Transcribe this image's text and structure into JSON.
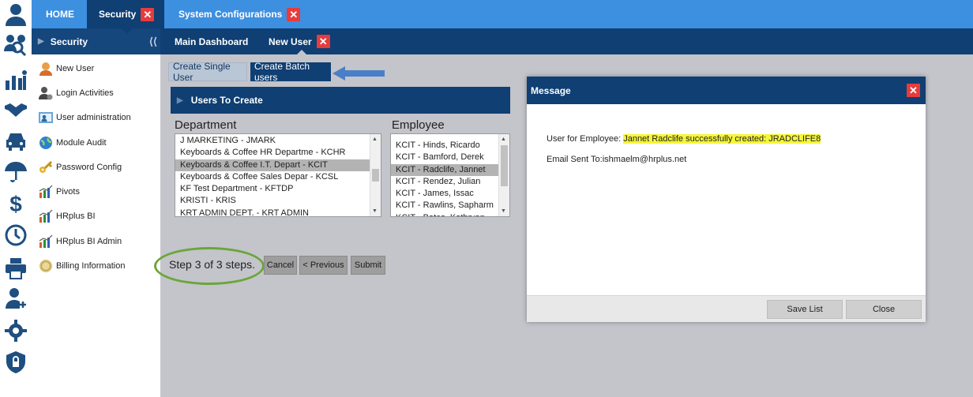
{
  "top_tabs": {
    "home": "HOME",
    "security": "Security",
    "system_configurations": "System Configurations",
    "close_glyph": "✕"
  },
  "sub_bar": {
    "section": "Security",
    "main_dashboard": "Main Dashboard",
    "new_user": "New User"
  },
  "sidebar": {
    "items": [
      {
        "label": "New User",
        "icon": "user-add-icon"
      },
      {
        "label": "Login Activities",
        "icon": "login-activity-icon"
      },
      {
        "label": "User administration",
        "icon": "user-admin-icon"
      },
      {
        "label": "Module Audit",
        "icon": "globe-icon"
      },
      {
        "label": "Password Config",
        "icon": "key-icon"
      },
      {
        "label": "Pivots",
        "icon": "bar-chart-icon"
      },
      {
        "label": "HRplus BI",
        "icon": "bar-chart-icon"
      },
      {
        "label": "HRplus BI Admin",
        "icon": "bar-chart-icon"
      },
      {
        "label": "Billing Information",
        "icon": "coin-icon"
      }
    ]
  },
  "rail_icons": [
    "person-icon",
    "users-search-icon",
    "people-chart-icon",
    "handshake-icon",
    "car-icon",
    "umbrella-icon",
    "dollar-icon",
    "clock-icon",
    "printer-icon",
    "add-person-icon",
    "settings-icon",
    "shield-lock-icon"
  ],
  "create": {
    "single": "Create Single User",
    "batch": "Create Batch users"
  },
  "panel": {
    "title": "Users To Create",
    "department_label": "Department",
    "employee_label": "Employee",
    "departments": [
      {
        "text": "J MARKETING - JMARK",
        "selected": false
      },
      {
        "text": "Keyboards & Coffee HR Departme - KCHR",
        "selected": false
      },
      {
        "text": "Keyboards & Coffee I.T. Depart - KCIT",
        "selected": true
      },
      {
        "text": "Keyboards & Coffee Sales Depar - KCSL",
        "selected": false
      },
      {
        "text": "KF Test Department - KFTDP",
        "selected": false
      },
      {
        "text": "KRISTI - KRIS",
        "selected": false
      },
      {
        "text": "KRT ADMIN DEPT. - KRT ADMIN",
        "selected": false
      }
    ],
    "employees": [
      {
        "text": "KCIT - Hinds, Ricardo",
        "selected": false
      },
      {
        "text": "KCIT - Bamford, Derek",
        "selected": false
      },
      {
        "text": "KCIT - Radclife, Jannet",
        "selected": true
      },
      {
        "text": "KCIT - Rendez, Julian",
        "selected": false
      },
      {
        "text": "KCIT - James, Issac",
        "selected": false
      },
      {
        "text": "KCIT - Rawlins, Sapharm",
        "selected": false
      },
      {
        "text": "KCIT - Bates, Kathryan",
        "selected": false
      }
    ]
  },
  "wizard": {
    "step": "Step 3 of 3 steps.",
    "cancel": "Cancel",
    "previous": "< Previous",
    "submit": "Submit"
  },
  "dialog": {
    "title": "Message",
    "line1_prefix": "User for Employee: ",
    "line1_highlight": "Jannet Radclife successfully created: JRADCLIFE8",
    "line2": "Email Sent To:ishmaelm@hrplus.net",
    "save_list": "Save List",
    "close": "Close"
  },
  "colors": {
    "topbar": "#3d8fe0",
    "navy": "#0f3f73",
    "close_red": "#e63c3c",
    "highlight": "#f5f53a",
    "annotation_green": "#6aa63a",
    "annotation_arrow": "#4a7fc8"
  }
}
